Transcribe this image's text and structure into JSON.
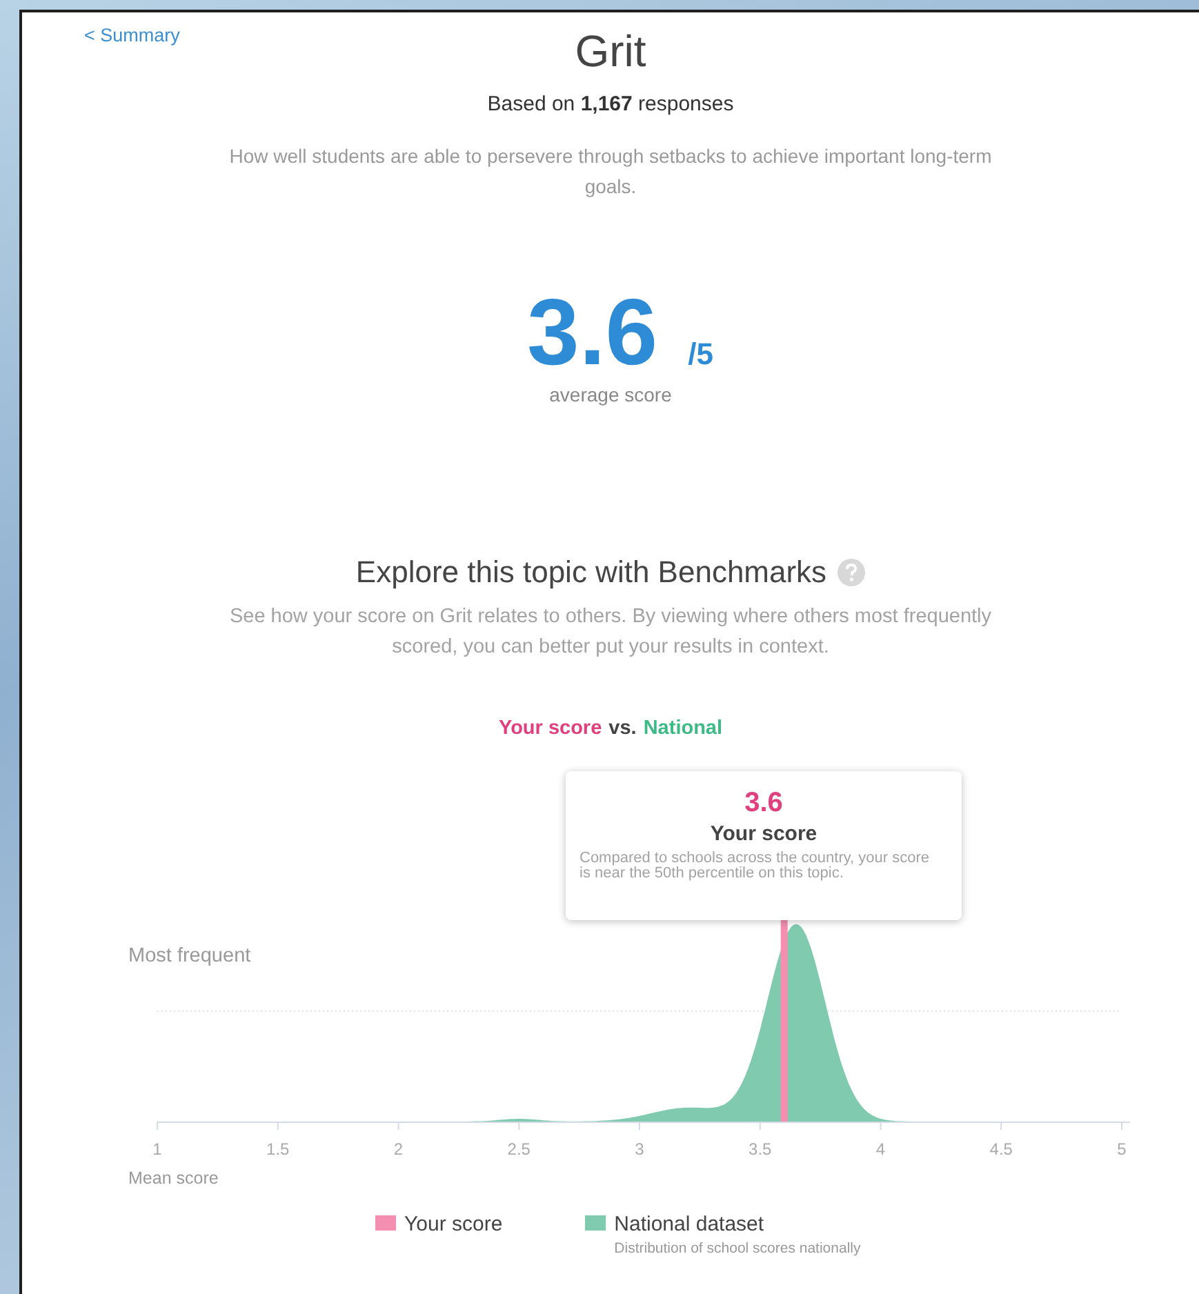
{
  "back_link": "< Summary",
  "title": "Grit",
  "subtitle": "Based on **1,167** responses",
  "description": "How well students are able to persevere through setbacks to achieve important long-term goals.",
  "score": {
    "value": "3.6",
    "out_of": "/5",
    "caption": "average score"
  },
  "benchmarks": {
    "heading": "Explore this topic with Benchmarks",
    "text": "See how your score on Grit relates to others. By viewing where others most frequently scored, you can better put your results in context.",
    "comparison": {
      "yours": "Your score",
      "joiner": "vs.",
      "other": "National"
    }
  },
  "tooltip": {
    "value": "3.6",
    "label": "Your score",
    "text": "Compared to schools across the country, your score is near the 50th percentile on this topic."
  },
  "chart": {
    "y_label": "Most frequent",
    "x_label": "Mean score",
    "x_ticks": [
      "1",
      "1.5",
      "2",
      "2.5",
      "3",
      "3.5",
      "4",
      "4.5",
      "5"
    ]
  },
  "legend": [
    {
      "label": "Your score",
      "color": "#f48fb1"
    },
    {
      "label": "National dataset",
      "color": "#80cbb0",
      "note": "Distribution of school scores nationally"
    }
  ]
}
